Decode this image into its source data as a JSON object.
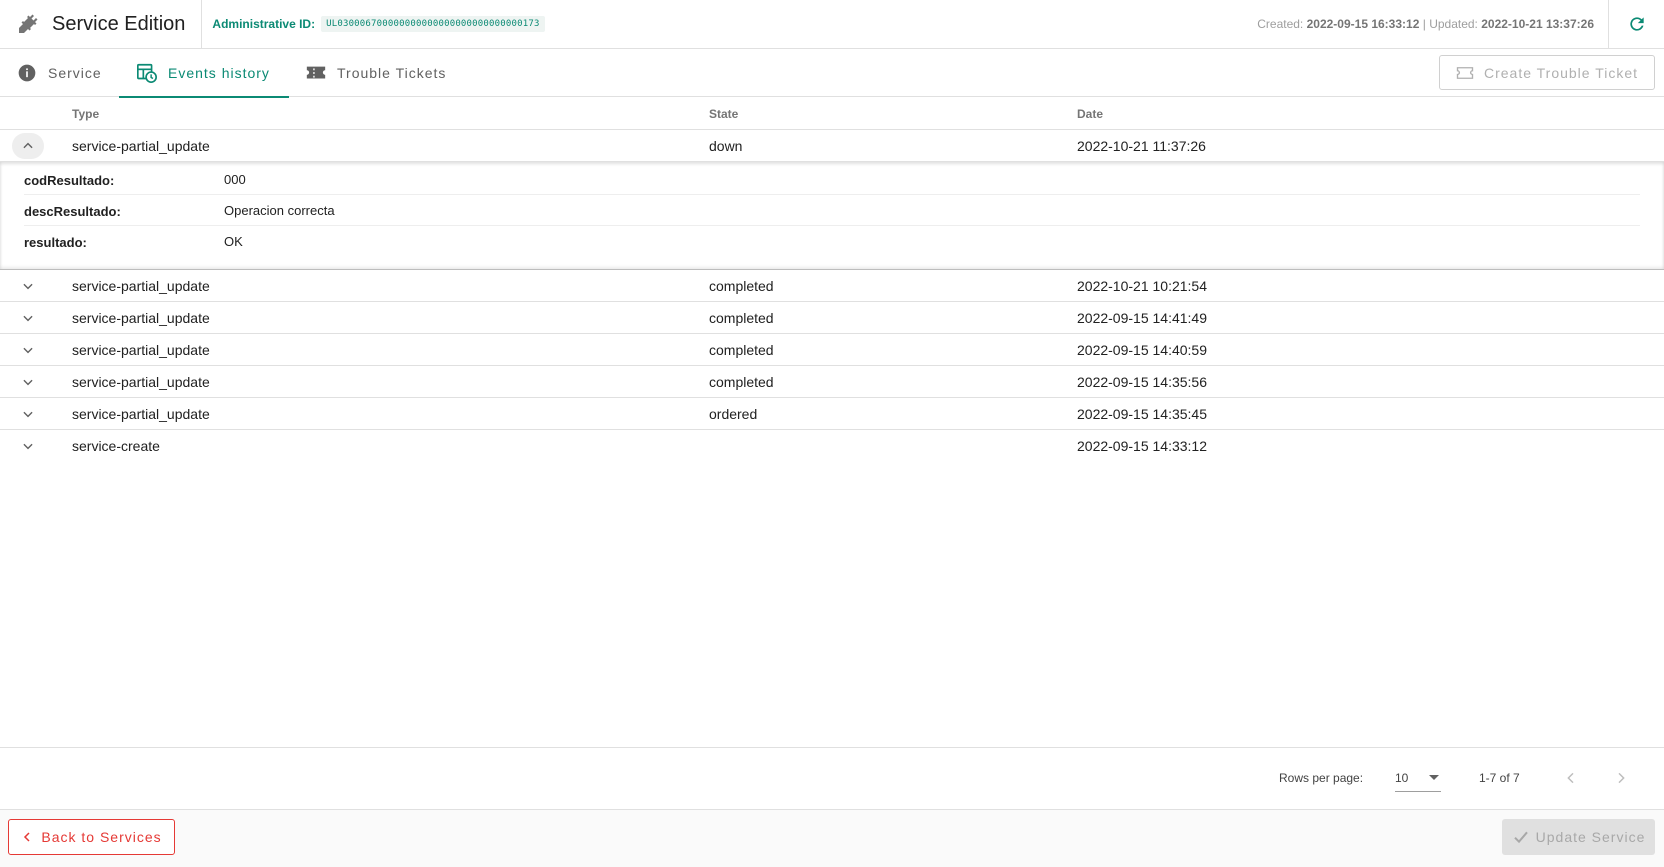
{
  "header": {
    "title": "Service Edition",
    "admin_label": "Administrative ID:",
    "admin_value": "UL030006700000000000000000000000000173",
    "created_label": "Created:",
    "created_value": "2022-09-15 16:33:12",
    "separator": "|",
    "updated_label": "Updated:",
    "updated_value": "2022-10-21 13:37:26",
    "icons": {
      "app": "plug-icon",
      "refresh": "refresh-icon"
    }
  },
  "tabs": [
    {
      "label": "Service",
      "icon": "info-icon",
      "active": false
    },
    {
      "label": "Events history",
      "icon": "history-icon",
      "active": true
    },
    {
      "label": "Trouble Tickets",
      "icon": "ticket-icon",
      "active": false
    }
  ],
  "create_ticket_label": "Create Trouble Ticket",
  "table": {
    "columns": [
      "Type",
      "State",
      "Date"
    ],
    "rows": [
      {
        "type": "service-partial_update",
        "state": "down",
        "date": "2022-10-21 11:37:26",
        "expanded": true
      },
      {
        "type": "service-partial_update",
        "state": "completed",
        "date": "2022-10-21 10:21:54"
      },
      {
        "type": "service-partial_update",
        "state": "completed",
        "date": "2022-09-15 14:41:49"
      },
      {
        "type": "service-partial_update",
        "state": "completed",
        "date": "2022-09-15 14:40:59"
      },
      {
        "type": "service-partial_update",
        "state": "completed",
        "date": "2022-09-15 14:35:56"
      },
      {
        "type": "service-partial_update",
        "state": "ordered",
        "date": "2022-09-15 14:35:45"
      },
      {
        "type": "service-create",
        "state": "",
        "date": "2022-09-15 14:33:12"
      }
    ],
    "detail": [
      {
        "key": "codResultado:",
        "value": "000"
      },
      {
        "key": "descResultado:",
        "value": "Operacion correcta"
      },
      {
        "key": "resultado:",
        "value": "OK"
      }
    ]
  },
  "pagination": {
    "rows_per_page_label": "Rows per page:",
    "rows_per_page_value": "10",
    "range": "1-7 of 7"
  },
  "footer": {
    "back_label": "Back to Services",
    "update_label": "Update Service"
  },
  "colors": {
    "accent": "#0b8a74",
    "danger": "#e53935",
    "disabled": "#e0e0e0"
  }
}
